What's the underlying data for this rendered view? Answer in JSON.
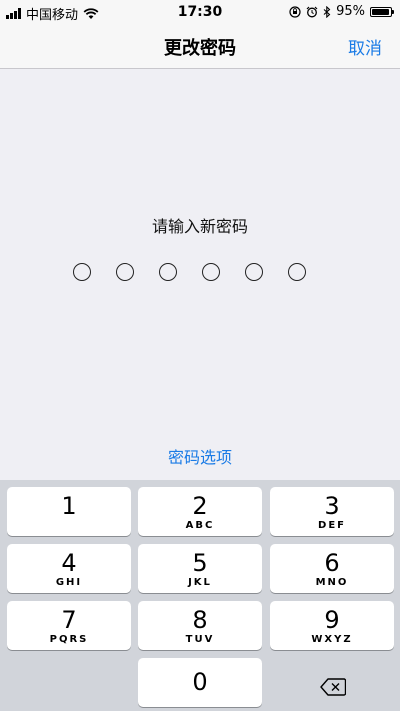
{
  "status_bar": {
    "carrier": "中国移动",
    "time": "17:30",
    "battery_percent": "95%",
    "battery_level": 0.95,
    "icons": [
      "signal-icon",
      "wifi-icon",
      "lock-rotation-icon",
      "alarm-icon",
      "bluetooth-icon",
      "battery-icon"
    ]
  },
  "nav": {
    "title": "更改密码",
    "cancel_label": "取消"
  },
  "prompt": "请输入新密码",
  "passcode_dots": 6,
  "options_label": "密码选项",
  "keypad": {
    "keys": [
      {
        "num": "1",
        "letters": ""
      },
      {
        "num": "2",
        "letters": "ABC"
      },
      {
        "num": "3",
        "letters": "DEF"
      },
      {
        "num": "4",
        "letters": "GHI"
      },
      {
        "num": "5",
        "letters": "JKL"
      },
      {
        "num": "6",
        "letters": "MNO"
      },
      {
        "num": "7",
        "letters": "PQRS"
      },
      {
        "num": "8",
        "letters": "TUV"
      },
      {
        "num": "9",
        "letters": "WXYZ"
      },
      {
        "num": "0",
        "letters": ""
      }
    ],
    "delete_icon": "backspace-icon"
  },
  "colors": {
    "accent": "#1a7be6",
    "background": "#efeff4",
    "keypad_bg": "#d1d4da"
  }
}
